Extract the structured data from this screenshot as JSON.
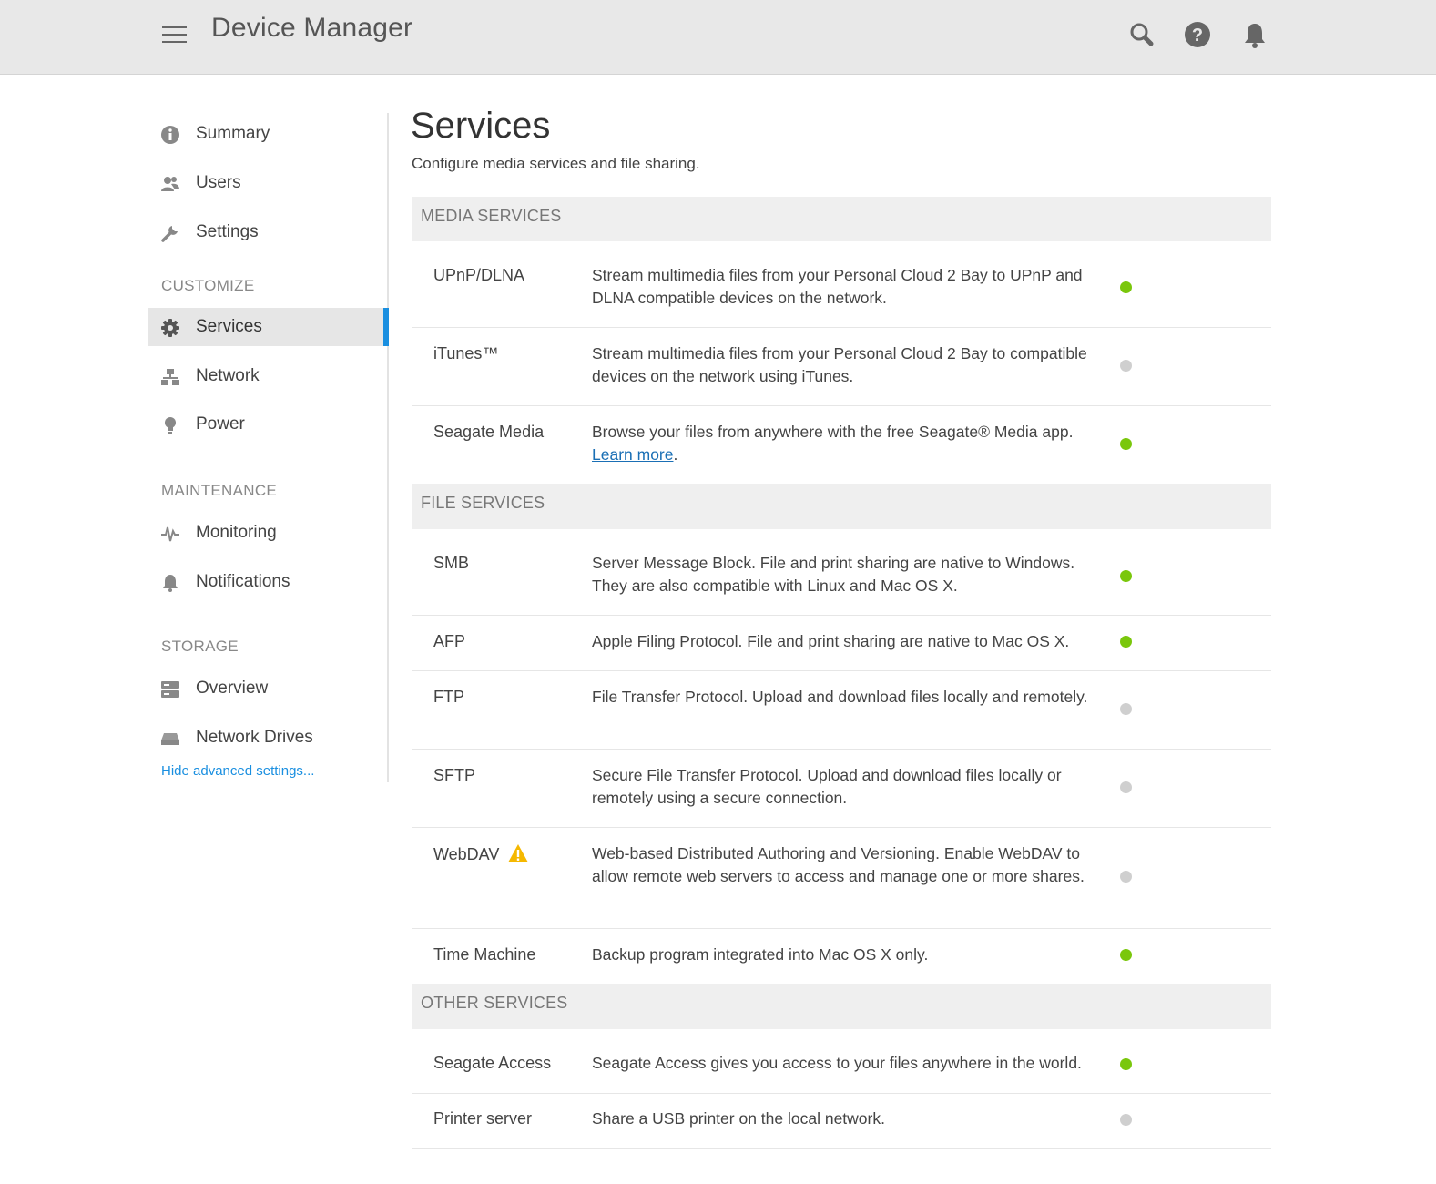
{
  "header": {
    "title": "Device Manager",
    "icons": [
      "menu-icon",
      "search-icon",
      "help-icon",
      "bell-icon"
    ]
  },
  "sidebar": {
    "items": [
      {
        "label": "Summary",
        "icon": "info-icon"
      },
      {
        "label": "Users",
        "icon": "users-icon"
      },
      {
        "label": "Settings",
        "icon": "wrench-icon"
      }
    ],
    "customize": {
      "heading": "CUSTOMIZE",
      "items": [
        {
          "label": "Services",
          "icon": "gear-icon",
          "active": true
        },
        {
          "label": "Network",
          "icon": "network-icon"
        },
        {
          "label": "Power",
          "icon": "bulb-icon"
        }
      ]
    },
    "maintenance": {
      "heading": "MAINTENANCE",
      "items": [
        {
          "label": "Monitoring",
          "icon": "pulse-icon"
        },
        {
          "label": "Notifications",
          "icon": "bell-icon"
        }
      ]
    },
    "storage": {
      "heading": "STORAGE",
      "items": [
        {
          "label": "Overview",
          "icon": "storage-icon"
        },
        {
          "label": "Network Drives",
          "icon": "drive-icon"
        }
      ]
    },
    "hide_link": "Hide advanced settings..."
  },
  "main": {
    "title": "Services",
    "subtitle": "Configure media services and file sharing.",
    "sections": [
      {
        "heading": "MEDIA SERVICES",
        "rows": [
          {
            "name": "UPnP/DLNA",
            "desc": "Stream multimedia files from your Personal Cloud 2 Bay to UPnP and DLNA compatible devices on the network.",
            "enabled": true
          },
          {
            "name": "iTunes™",
            "desc": "Stream multimedia files from your Personal Cloud 2 Bay to compatible devices on the network using iTunes.",
            "enabled": false
          },
          {
            "name": "Seagate Media",
            "desc": "Browse your files from anywhere with the free Seagate® Media app.",
            "link": "Learn more",
            "enabled": true
          }
        ]
      },
      {
        "heading": "FILE SERVICES",
        "rows": [
          {
            "name": "SMB",
            "desc": "Server Message Block. File and print sharing are native to Windows. They are also compatible with Linux and Mac OS X.",
            "enabled": true
          },
          {
            "name": "AFP",
            "desc": "Apple Filing Protocol. File and print sharing are native to Mac OS X.",
            "enabled": true
          },
          {
            "name": "FTP",
            "desc": "File Transfer Protocol. Upload and download files locally and remotely.",
            "enabled": false
          },
          {
            "name": "SFTP",
            "desc": "Secure File Transfer Protocol. Upload and download files locally or remotely using a secure connection.",
            "enabled": false
          },
          {
            "name": "WebDAV",
            "desc": "Web-based Distributed Authoring and Versioning. Enable WebDAV to allow remote web servers to access and manage one or more shares.",
            "enabled": false,
            "warning": true
          },
          {
            "name": "Time Machine",
            "desc": "Backup program integrated into Mac OS X only.",
            "enabled": true
          }
        ]
      },
      {
        "heading": "OTHER SERVICES",
        "rows": [
          {
            "name": "Seagate Access",
            "desc": "Seagate Access gives you access to your files anywhere in the world.",
            "enabled": true
          },
          {
            "name": "Printer server",
            "desc": "Share a USB printer on the local network.",
            "enabled": false
          }
        ]
      }
    ]
  },
  "colors": {
    "accent": "#1a8fe0",
    "status_on": "#7ac70c",
    "status_off": "#cfcfcf",
    "warning": "#f5b800"
  }
}
